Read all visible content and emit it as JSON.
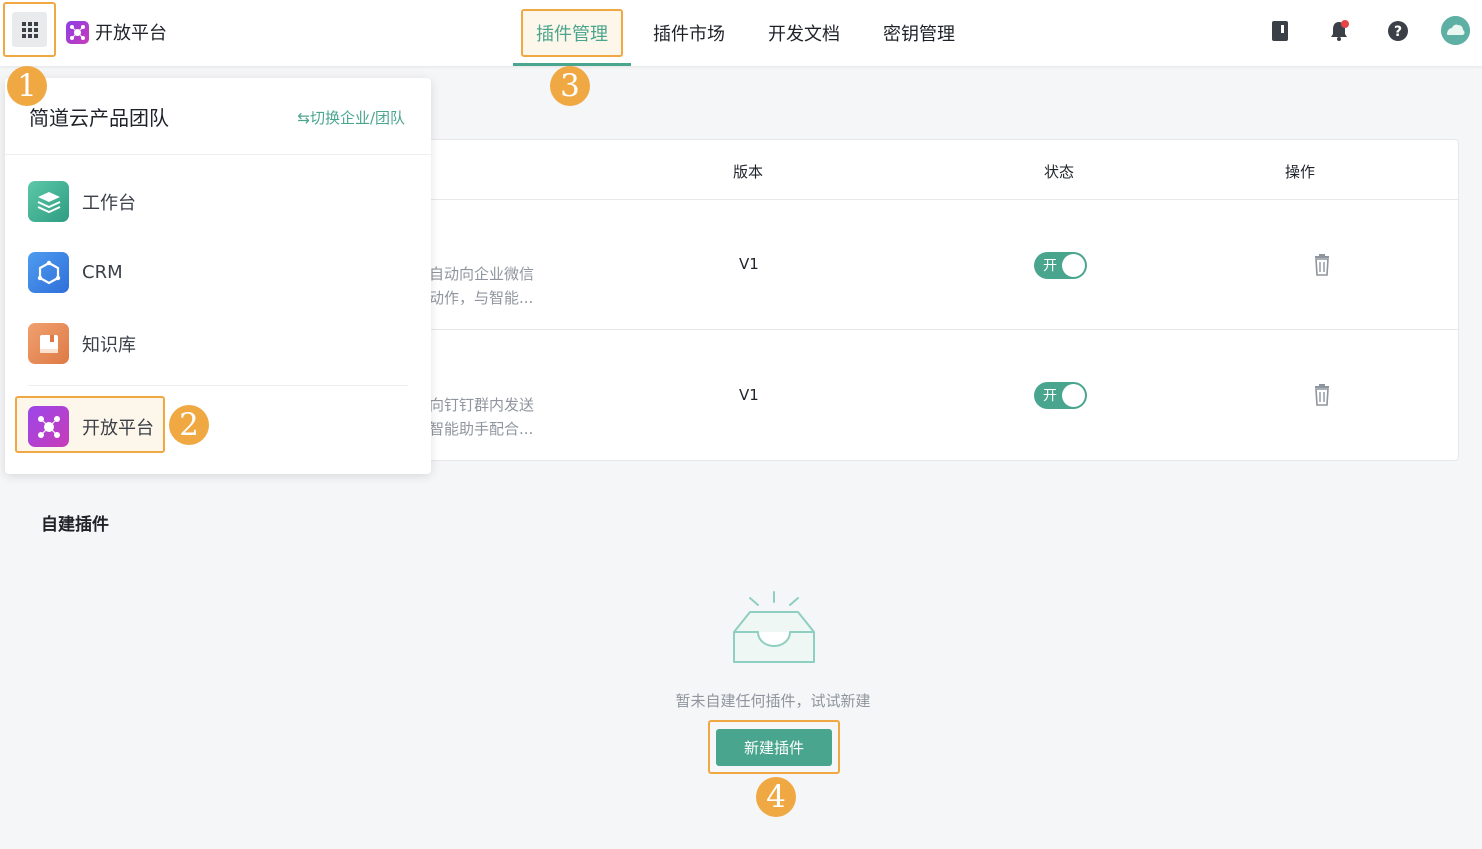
{
  "topbar": {
    "brand_title": "开放平台",
    "nav": [
      {
        "label": "插件管理",
        "active": true
      },
      {
        "label": "插件市场"
      },
      {
        "label": "开发文档"
      },
      {
        "label": "密钥管理"
      }
    ],
    "icons": [
      "apps-grid-icon",
      "book-icon",
      "bell-icon",
      "help-icon",
      "avatar"
    ]
  },
  "markers": [
    "1",
    "2",
    "3",
    "4"
  ],
  "panel": {
    "team_name": "简道云产品团队",
    "switch_label": "⇆切换企业/团队",
    "apps": [
      {
        "label": "工作台",
        "icon": "layers-icon"
      },
      {
        "label": "CRM",
        "icon": "hexagon-icon"
      },
      {
        "label": "知识库",
        "icon": "book-icon"
      },
      {
        "label": "开放平台",
        "icon": "open-platform-icon"
      }
    ]
  },
  "table": {
    "headers": {
      "version": "版本",
      "status": "状态",
      "action": "操作"
    },
    "rows": [
      {
        "desc_line1": "自动向企业微信",
        "desc_line2": "动作，与智能...",
        "version": "V1",
        "toggle": "开"
      },
      {
        "desc_line1": "向钉钉群内发送",
        "desc_line2": "智能助手配合...",
        "version": "V1",
        "toggle": "开"
      }
    ]
  },
  "section": {
    "title": "自建插件",
    "empty_text": "暂未自建任何插件，试试新建",
    "create_label": "新建插件"
  },
  "colors": {
    "accent": "#4aa58e",
    "highlight": "#f0a842"
  }
}
